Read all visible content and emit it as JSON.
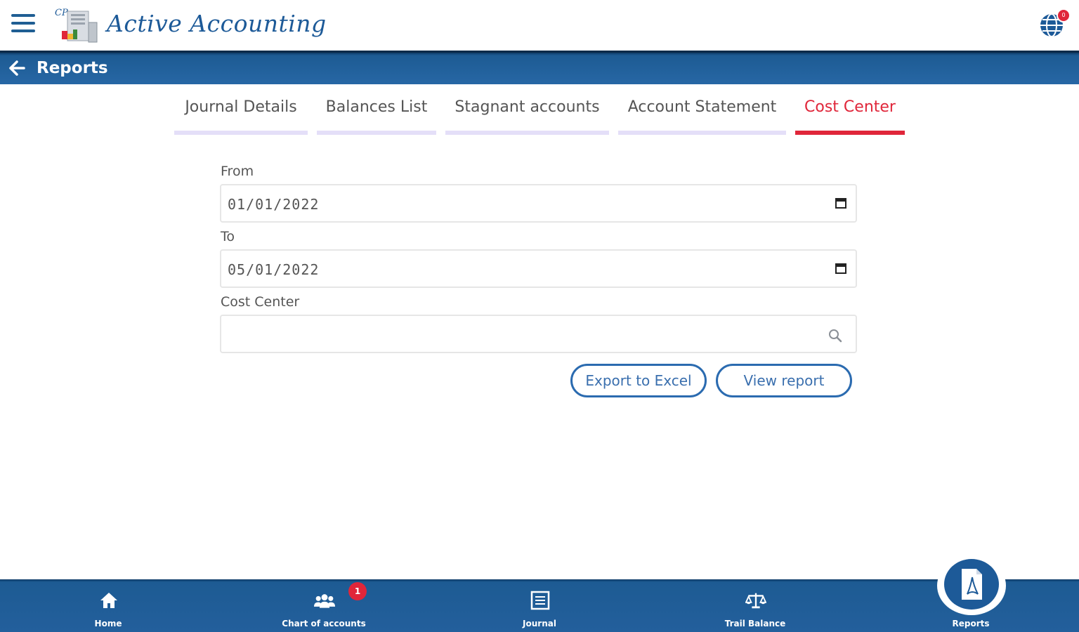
{
  "app": {
    "brand_name": "Active Accounting",
    "notification_count": "0"
  },
  "header": {
    "title": "Reports"
  },
  "tabs": [
    {
      "label": "Journal Details"
    },
    {
      "label": "Balances List"
    },
    {
      "label": "Stagnant accounts"
    },
    {
      "label": "Account Statement"
    },
    {
      "label": "Cost Center",
      "active": true
    }
  ],
  "form": {
    "from_label": "From",
    "from_value": "01/01/2022",
    "to_label": "To",
    "to_value": "05/01/2022",
    "cost_center_label": "Cost Center",
    "cost_center_value": ""
  },
  "actions": {
    "export_label": "Export to Excel",
    "view_label": "View report"
  },
  "bottom_nav": {
    "items": [
      {
        "label": "Home",
        "icon": "home-icon"
      },
      {
        "label": "Chart of accounts",
        "icon": "users-icon",
        "badge": "1"
      },
      {
        "label": "Journal",
        "icon": "journal-icon"
      },
      {
        "label": "Trail Balance",
        "icon": "scale-icon"
      },
      {
        "label": "Reports",
        "icon": "pdf-icon",
        "active": true
      }
    ]
  },
  "colors": {
    "primary": "#1d5b93",
    "accent": "#e0263a",
    "tab_inactive_bar": "#e4dff8"
  }
}
